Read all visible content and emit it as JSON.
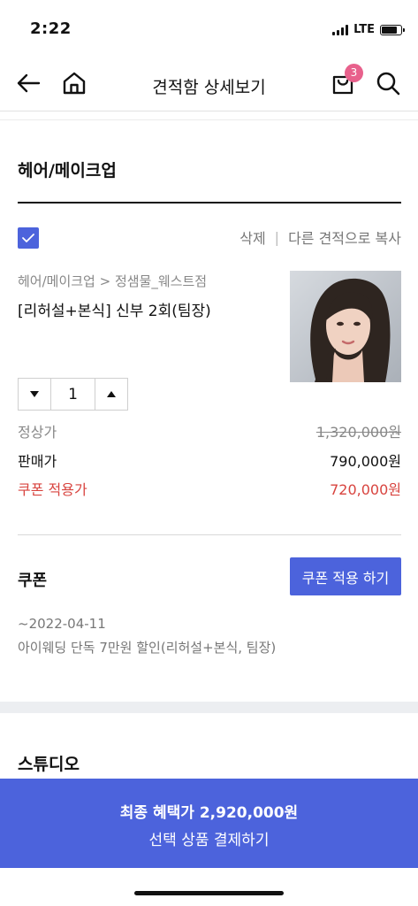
{
  "status": {
    "time": "2:22",
    "network": "LTE"
  },
  "nav": {
    "title": "견적함 상세보기",
    "cart_count": "3"
  },
  "section": {
    "title": "헤어/메이크업"
  },
  "item": {
    "actions": {
      "delete": "삭제",
      "separator": "|",
      "copy": "다른 견적으로 복사"
    },
    "breadcrumb": "헤어/메이크업 > 정샘물_웨스트점",
    "name": "[리허설+본식] 신부 2회(팀장)",
    "quantity": "1",
    "prices": {
      "regular_label": "정상가",
      "regular_value": "1,320,000원",
      "sale_label": "판매가",
      "sale_value": "790,000원",
      "coupon_label": "쿠폰 적용가",
      "coupon_value": "720,000원"
    }
  },
  "coupon": {
    "title": "쿠폰",
    "apply_button": "쿠폰 적용 하기",
    "date": "~2022-04-11",
    "description": "아이웨딩 단독 7만원 할인(리허설+본식, 팀장)"
  },
  "next_section": {
    "title": "스튜디오"
  },
  "bottom_bar": {
    "total": "최종 혜택가 2,920,000원",
    "checkout": "선택 상품 결제하기"
  },
  "colors": {
    "accent": "#4c63dc",
    "coupon": "#d8443f",
    "badge": "#e8618c"
  },
  "icons": [
    "back-arrow-icon",
    "home-icon",
    "shopping-bag-icon",
    "search-icon",
    "check-icon",
    "triangle-down-icon",
    "triangle-up-icon"
  ]
}
